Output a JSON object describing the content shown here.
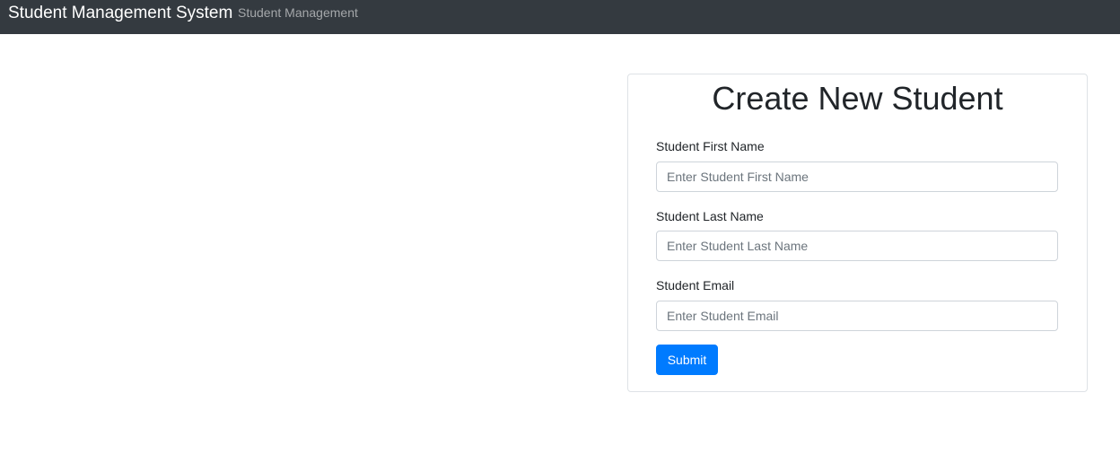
{
  "navbar": {
    "brand": "Student Management System",
    "links": [
      {
        "label": "Student Management"
      }
    ]
  },
  "form": {
    "title": "Create New Student",
    "fields": [
      {
        "label": "Student First Name",
        "placeholder": "Enter Student First Name",
        "value": ""
      },
      {
        "label": "Student Last Name",
        "placeholder": "Enter Student Last Name",
        "value": ""
      },
      {
        "label": "Student Email",
        "placeholder": "Enter Student Email",
        "value": ""
      }
    ],
    "submit_label": "Submit"
  },
  "colors": {
    "navbar_bg": "#343a40",
    "primary": "#007bff",
    "border": "#dee2e6"
  }
}
